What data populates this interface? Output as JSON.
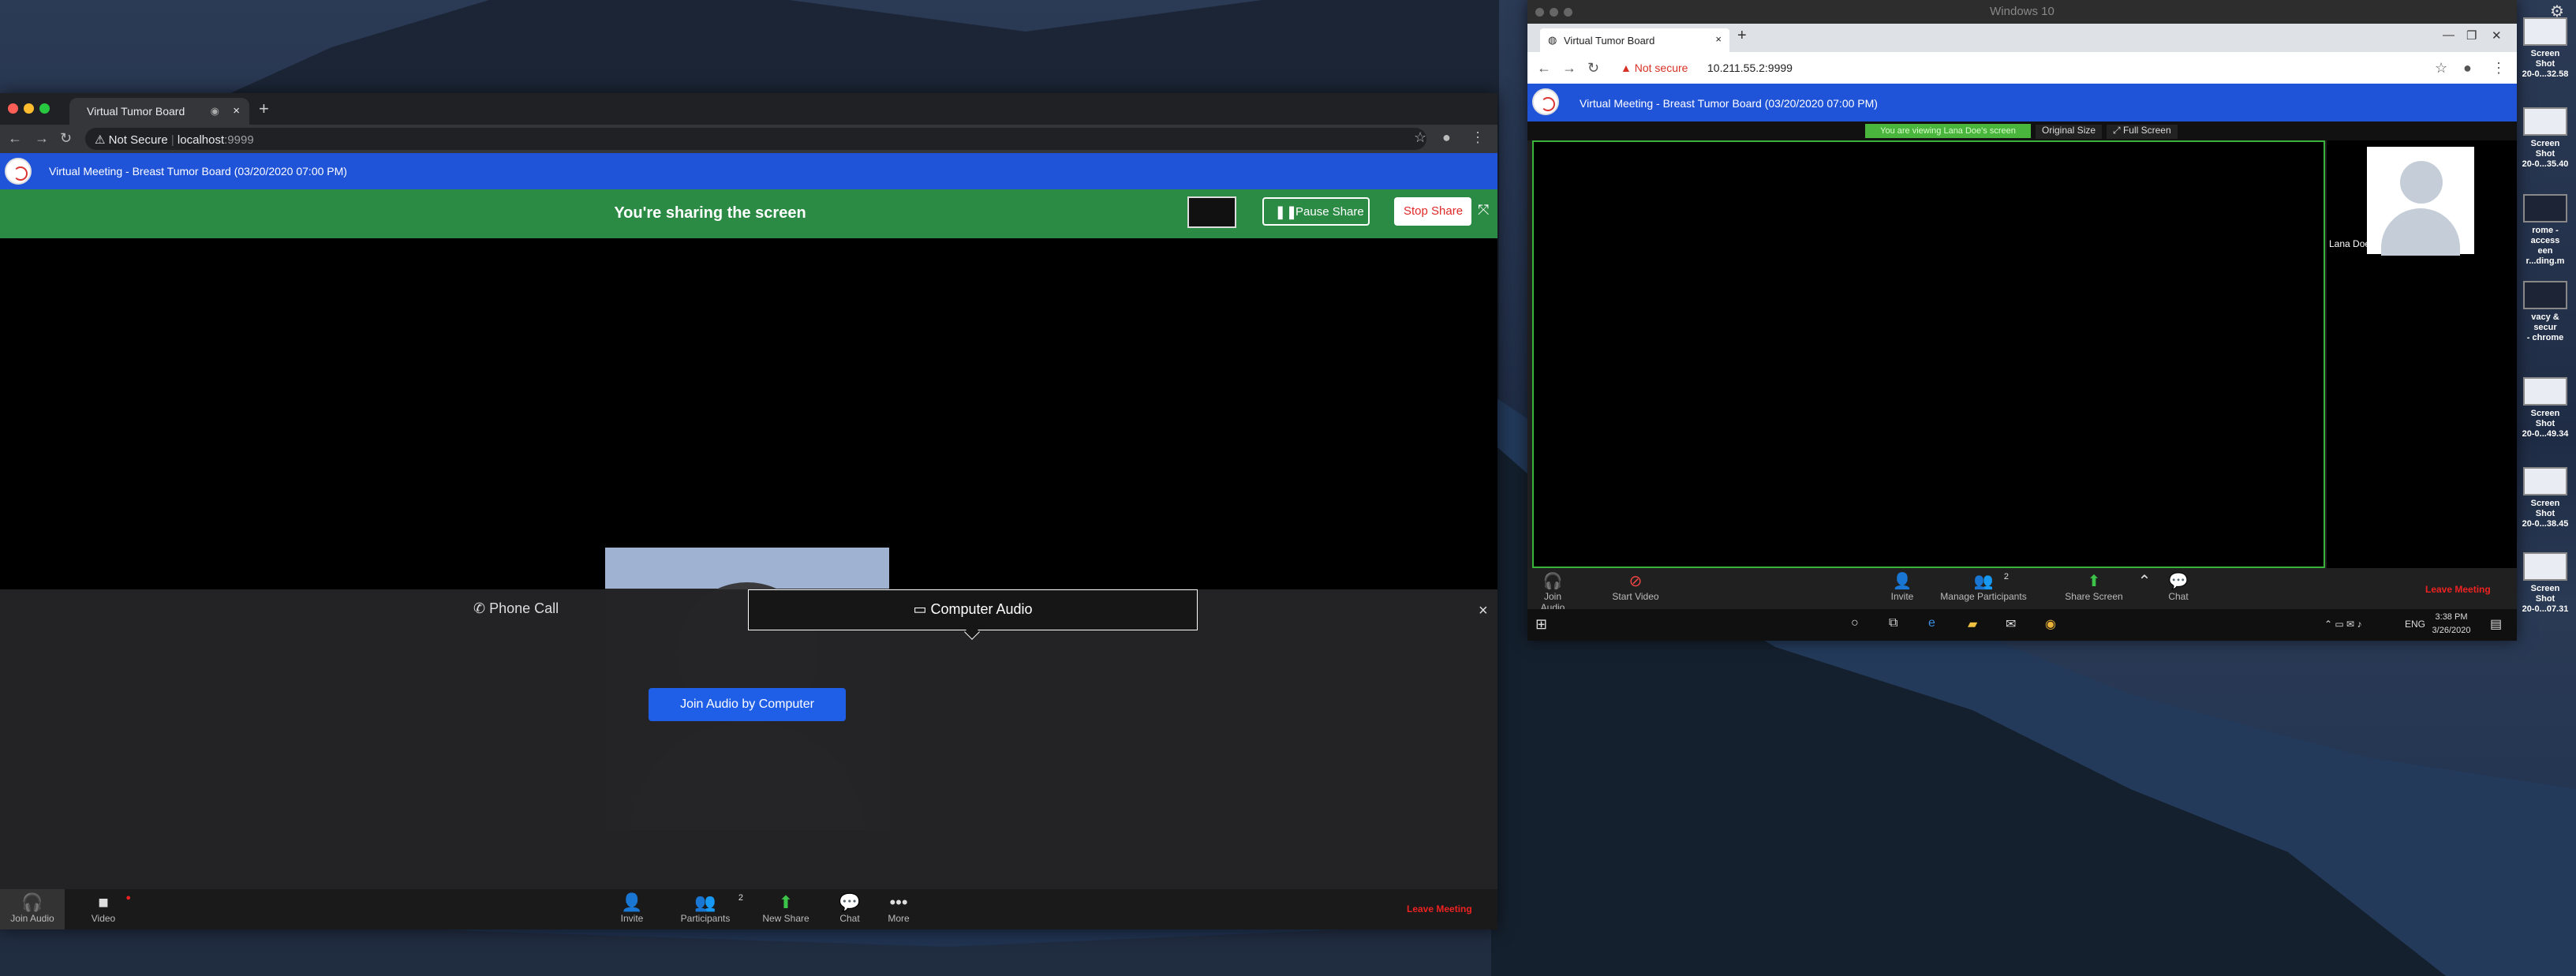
{
  "left_window": {
    "tab_title": "Virtual Tumor Board",
    "new_tab": "+",
    "address": {
      "security": "Not Secure",
      "host": "localhost",
      "port": ":9999"
    },
    "meeting_title": "Virtual Meeting - Breast Tumor Board (03/20/2020 07:00 PM)",
    "share_banner": "You're sharing the screen",
    "pause_label": "Pause Share",
    "stop_label": "Stop Share",
    "audio": {
      "phone_label": "Phone Call",
      "computer_label": "Computer Audio",
      "join_label": "Join Audio by Computer"
    },
    "toolbar": {
      "join_audio": "Join Audio",
      "video": "Video",
      "invite": "Invite",
      "participants": "Participants",
      "participants_count": "2",
      "new_share": "New Share",
      "chat": "Chat",
      "more": "More",
      "leave": "Leave Meeting"
    }
  },
  "right_window": {
    "vm_title": "Windows 10",
    "tab_title": "Virtual Tumor Board",
    "address": {
      "security": "Not secure",
      "url": "10.211.55.2:9999"
    },
    "meeting_title": "Virtual Meeting - Breast Tumor Board (03/20/2020 07:00 PM)",
    "viewing_label": "You are viewing Lana Doe's screen",
    "original_size": "Original Size",
    "full_screen": "Full Screen",
    "participant_name": "Lana Doe",
    "toolbar": {
      "join_audio": "Join Audio",
      "start_video": "Start Video",
      "invite": "Invite",
      "manage_participants": "Manage Participants",
      "participants_count": "2",
      "share_screen": "Share Screen",
      "chat": "Chat",
      "leave": "Leave Meeting"
    },
    "taskbar": {
      "lang": "ENG",
      "time": "3:38 PM",
      "date": "3/26/2020"
    }
  },
  "desktop_icons": [
    {
      "line1": "Screen Shot",
      "line2": "20-0...32.58"
    },
    {
      "line1": "Screen Shot",
      "line2": "20-0...35.40"
    },
    {
      "line1": "rome - access",
      "line2": "een r...ding.m"
    },
    {
      "line1": "vacy & secur",
      "line2": "- chrome"
    },
    {
      "line1": "Screen Shot",
      "line2": "20-0...49.34"
    },
    {
      "line1": "Screen Shot",
      "line2": "20-0...38.45"
    },
    {
      "line1": "Screen Shot",
      "line2": "20-0...07.31"
    }
  ],
  "colors": {
    "zoom_blue": "#1f53d8",
    "share_green": "#2b8a44",
    "leave_red": "#e22222"
  }
}
